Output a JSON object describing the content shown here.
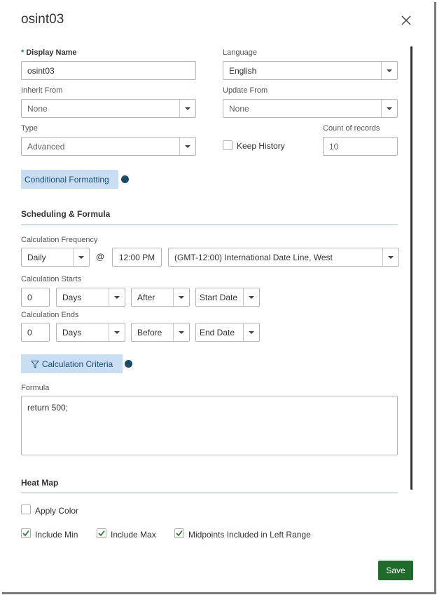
{
  "dialog": {
    "title": "osint03"
  },
  "fields": {
    "display_name": {
      "required_marker": "*",
      "label": "Display Name",
      "value": "osint03"
    },
    "language": {
      "label": "Language",
      "value": "English"
    },
    "inherit_from": {
      "label": "Inherit From",
      "value": "None"
    },
    "update_from": {
      "label": "Update From",
      "value": "None"
    },
    "type": {
      "label": "Type",
      "value": "Advanced"
    },
    "keep_history": {
      "label": "Keep History",
      "checked": false
    },
    "count_of_records": {
      "label": "Count of records",
      "value": "10"
    }
  },
  "conditional_formatting": {
    "label": "Conditional Formatting"
  },
  "scheduling": {
    "section_title": "Scheduling & Formula",
    "frequency": {
      "label": "Calculation Frequency",
      "value": "Daily",
      "at": "@",
      "time": "12:00 PM",
      "timezone": "(GMT-12:00) International Date Line, West"
    },
    "starts": {
      "label": "Calculation Starts",
      "number": "0",
      "unit": "Days",
      "relation": "After",
      "anchor": "Start Date"
    },
    "ends": {
      "label": "Calculation Ends",
      "number": "0",
      "unit": "Days",
      "relation": "Before",
      "anchor": "End Date"
    },
    "criteria": {
      "label": "Calculation Criteria"
    },
    "formula": {
      "label": "Formula",
      "value": "return 500;"
    }
  },
  "heat_map": {
    "section_title": "Heat Map",
    "apply_color": {
      "label": "Apply Color",
      "checked": false
    },
    "include_min": {
      "label": "Include Min",
      "checked": true
    },
    "include_max": {
      "label": "Include Max",
      "checked": true
    },
    "midpoints_left": {
      "label": "Midpoints Included in Left Range",
      "checked": true
    }
  },
  "footer": {
    "save_label": "Save"
  },
  "colors": {
    "accent": "#1e6b2c",
    "pill": "#c9def2",
    "dot": "#1a4b66",
    "required": "#2e7d32"
  }
}
